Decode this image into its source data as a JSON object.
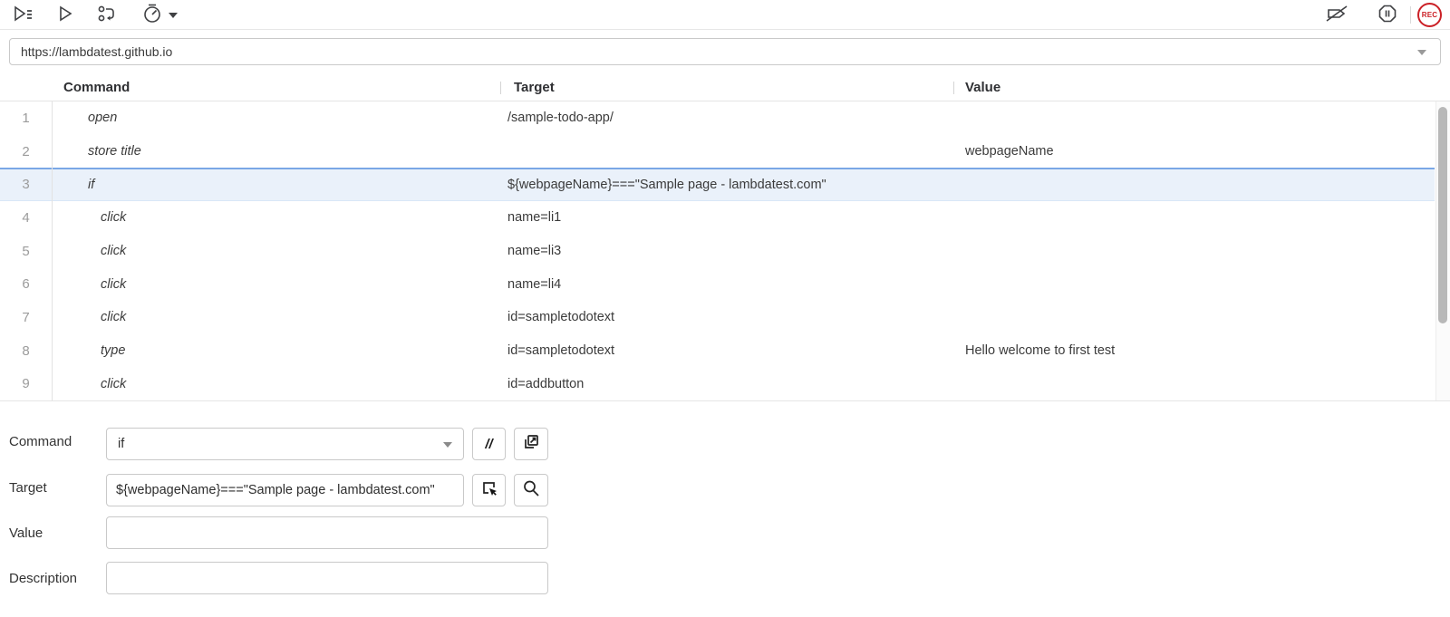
{
  "toolbar": {
    "left_icons": [
      {
        "name": "run-all-tests-icon",
        "label": "Run all tests"
      },
      {
        "name": "run-current-test-icon",
        "label": "Run current test"
      },
      {
        "name": "step-over-icon",
        "label": "Step over current command"
      },
      {
        "name": "test-speed-icon",
        "label": "Test execution speed"
      }
    ],
    "right_icons": [
      {
        "name": "disable-breakpoints-icon",
        "label": "Disable breakpoints"
      },
      {
        "name": "pause-on-exceptions-icon",
        "label": "Pause on exceptions"
      }
    ],
    "rec_label": "REC"
  },
  "url_bar": {
    "value": "https://lambdatest.github.io"
  },
  "table": {
    "columns": [
      "Command",
      "Target",
      "Value"
    ],
    "rows": [
      {
        "num": 1,
        "command": "open",
        "target": "/sample-todo-app/",
        "value": "",
        "indent": 0,
        "selected": false
      },
      {
        "num": 2,
        "command": "store title",
        "target": "",
        "value": "webpageName",
        "indent": 0,
        "selected": false
      },
      {
        "num": 3,
        "command": "if",
        "target": "${webpageName}===\"Sample page - lambdatest.com\"",
        "value": "",
        "indent": 0,
        "selected": true
      },
      {
        "num": 4,
        "command": "click",
        "target": "name=li1",
        "value": "",
        "indent": 1,
        "selected": false
      },
      {
        "num": 5,
        "command": "click",
        "target": "name=li3",
        "value": "",
        "indent": 1,
        "selected": false
      },
      {
        "num": 6,
        "command": "click",
        "target": "name=li4",
        "value": "",
        "indent": 1,
        "selected": false
      },
      {
        "num": 7,
        "command": "click",
        "target": "id=sampletodotext",
        "value": "",
        "indent": 1,
        "selected": false
      },
      {
        "num": 8,
        "command": "type",
        "target": "id=sampletodotext",
        "value": "Hello welcome to first test",
        "indent": 1,
        "selected": false
      },
      {
        "num": 9,
        "command": "click",
        "target": "id=addbutton",
        "value": "",
        "indent": 1,
        "selected": false
      }
    ]
  },
  "form": {
    "command": {
      "label": "Command",
      "value": "if"
    },
    "target": {
      "label": "Target",
      "value": "${webpageName}===\"Sample page - lambdatest.com\""
    },
    "value": {
      "label": "Value",
      "value": ""
    },
    "description": {
      "label": "Description",
      "value": ""
    },
    "comment_button_glyph": "//"
  },
  "colors": {
    "selected_row_bg": "#eaf1fa",
    "selected_row_border": "#7aa7e6",
    "rec_red": "#cb2026"
  }
}
